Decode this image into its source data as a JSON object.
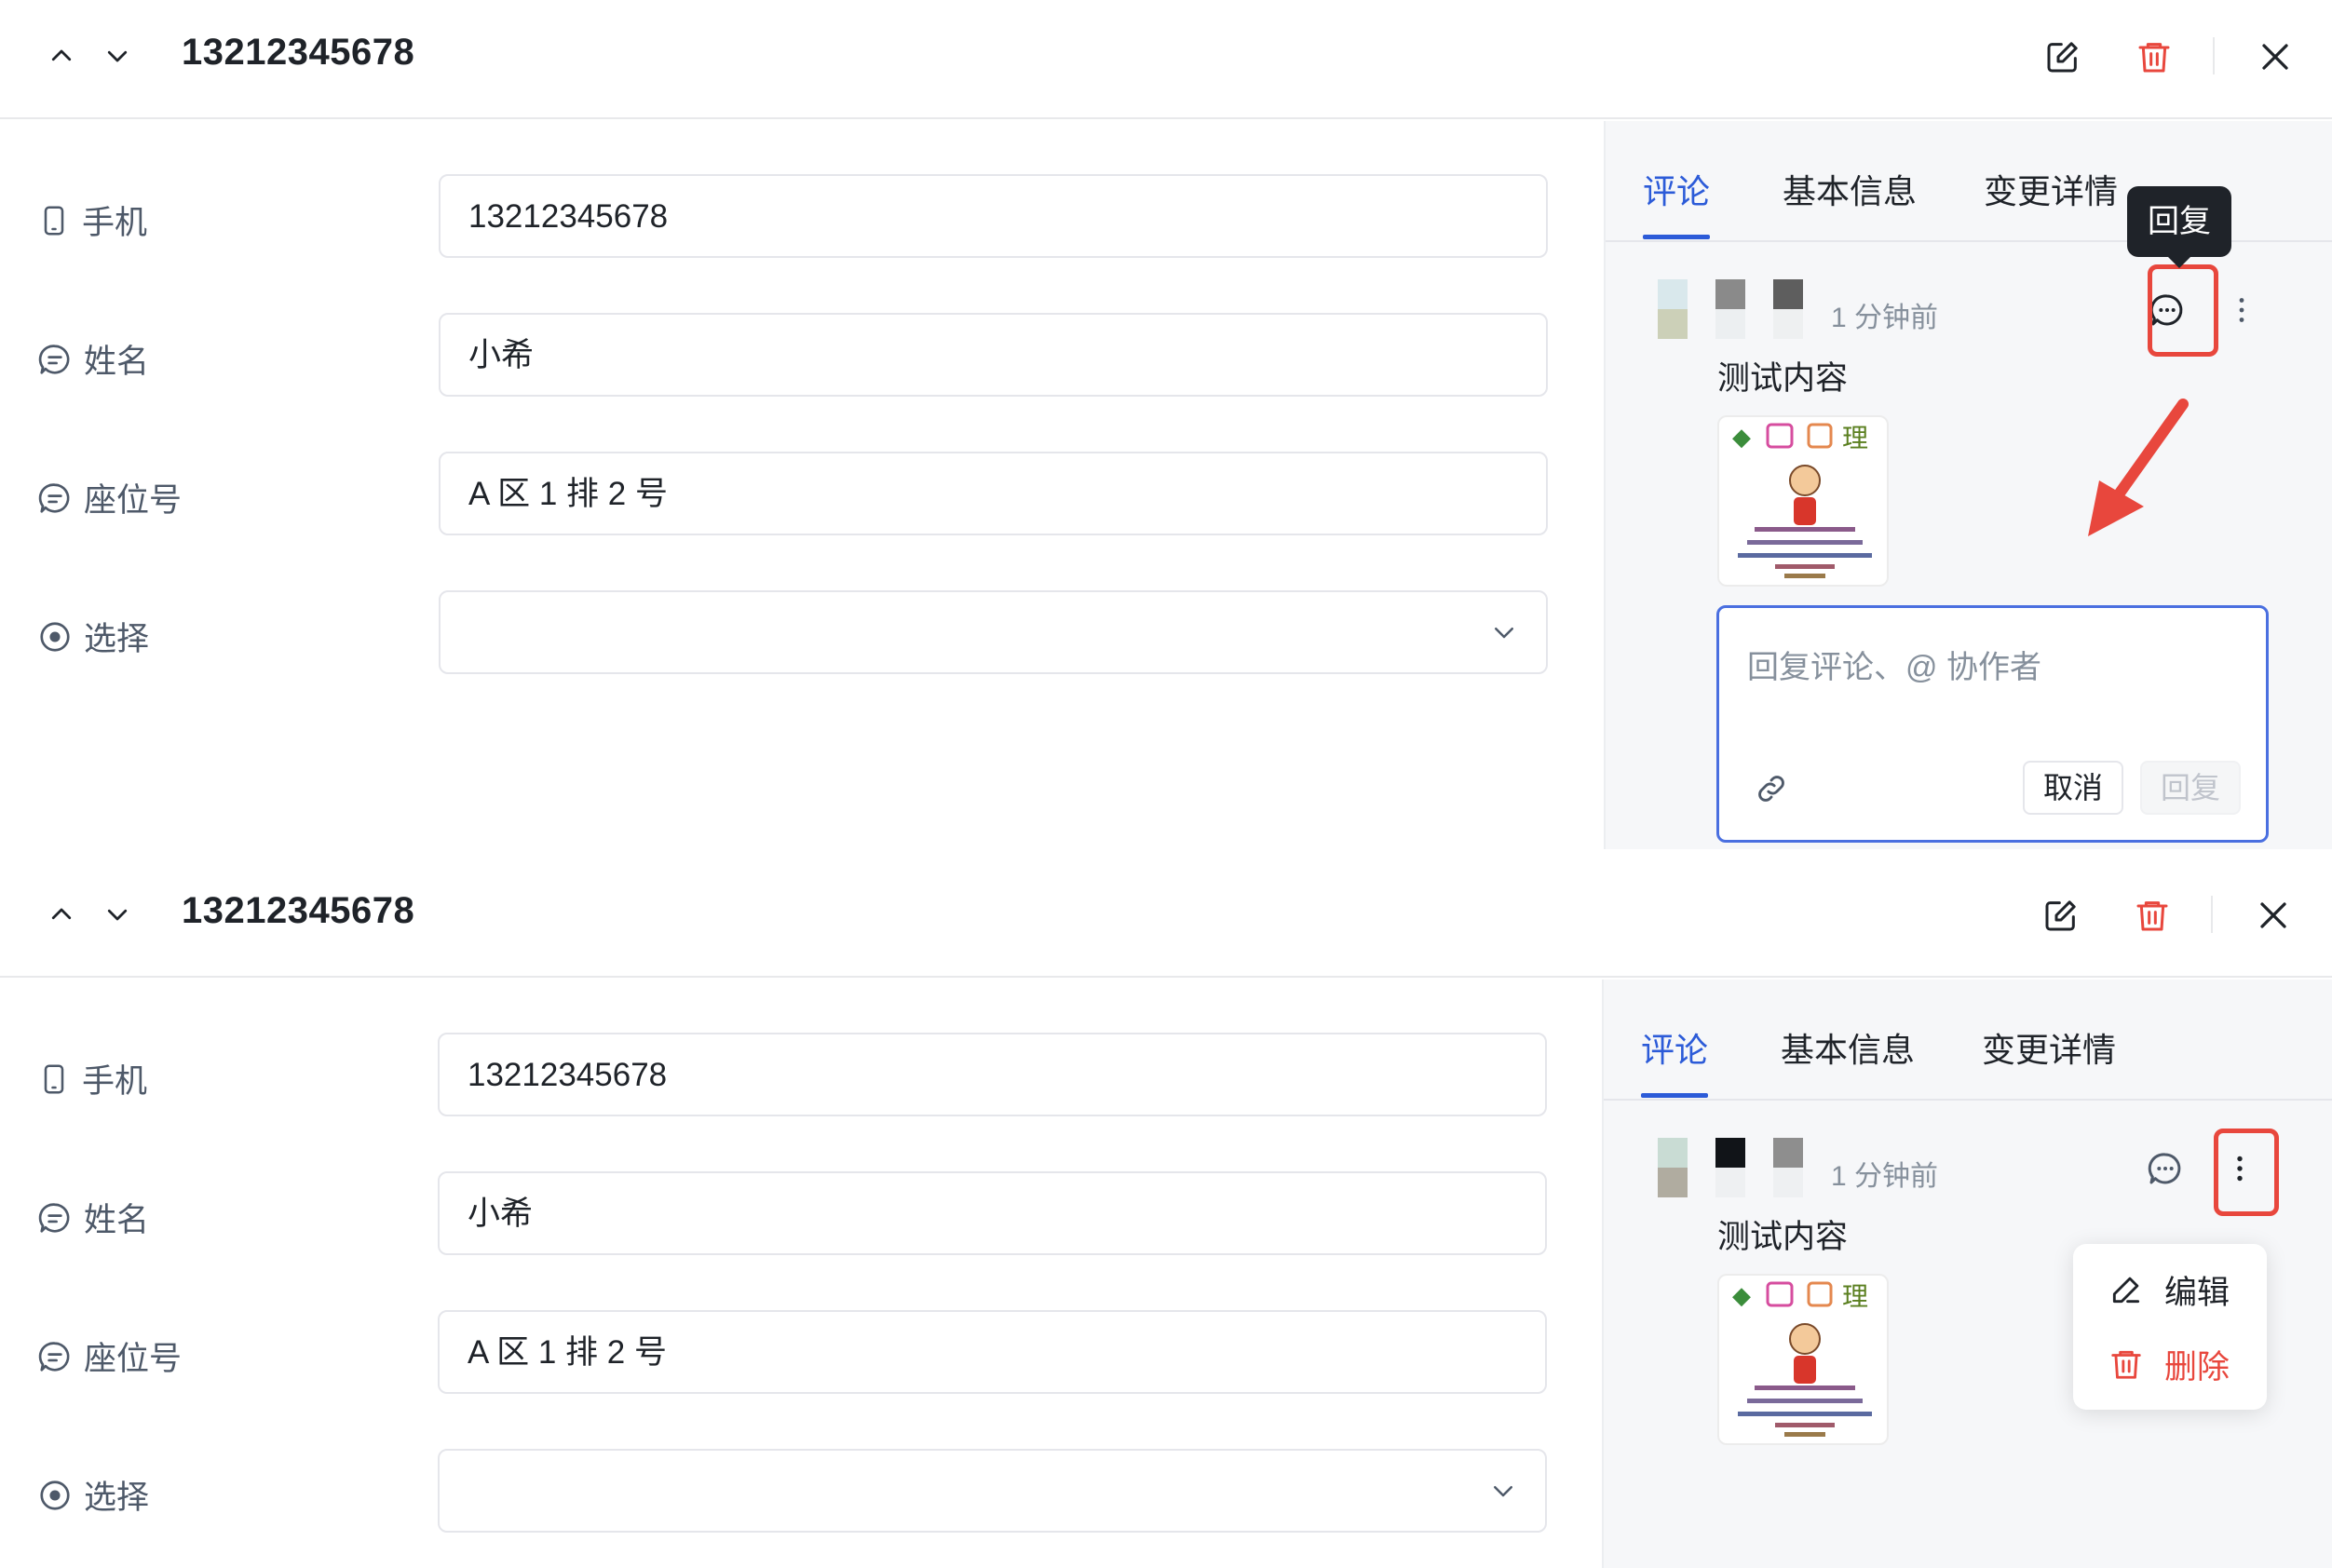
{
  "panels": [
    {
      "title": "13212345678",
      "fields": [
        {
          "label": "手机",
          "icon": "phone-icon",
          "value": "13212345678"
        },
        {
          "label": "姓名",
          "icon": "text-field-icon",
          "value": "小希"
        },
        {
          "label": "座位号",
          "icon": "text-field-icon",
          "value": "A 区 1 排 2 号"
        },
        {
          "label": "选择",
          "icon": "radio-select-icon",
          "value": ""
        }
      ],
      "tabs": [
        "评论",
        "基本信息",
        "变更详情"
      ],
      "active_tab": "评论",
      "comment": {
        "time": "1 分钟前",
        "text": "测试内容"
      },
      "tooltip": "回复",
      "reply": {
        "placeholder": "回复评论、@ 协作者",
        "cancel_label": "取消",
        "submit_label": "回复"
      }
    },
    {
      "title": "13212345678",
      "fields": [
        {
          "label": "手机",
          "icon": "phone-icon",
          "value": "13212345678"
        },
        {
          "label": "姓名",
          "icon": "text-field-icon",
          "value": "小希"
        },
        {
          "label": "座位号",
          "icon": "text-field-icon",
          "value": "A 区 1 排 2 号"
        },
        {
          "label": "选择",
          "icon": "radio-select-icon",
          "value": ""
        }
      ],
      "tabs": [
        "评论",
        "基本信息",
        "变更详情"
      ],
      "active_tab": "评论",
      "comment": {
        "time": "1 分钟前",
        "text": "测试内容"
      },
      "menu": {
        "edit_label": "编辑",
        "delete_label": "删除"
      }
    }
  ],
  "colors": {
    "accent": "#2c5bd8",
    "danger": "#e8473d",
    "annotation": "#e8473d"
  }
}
